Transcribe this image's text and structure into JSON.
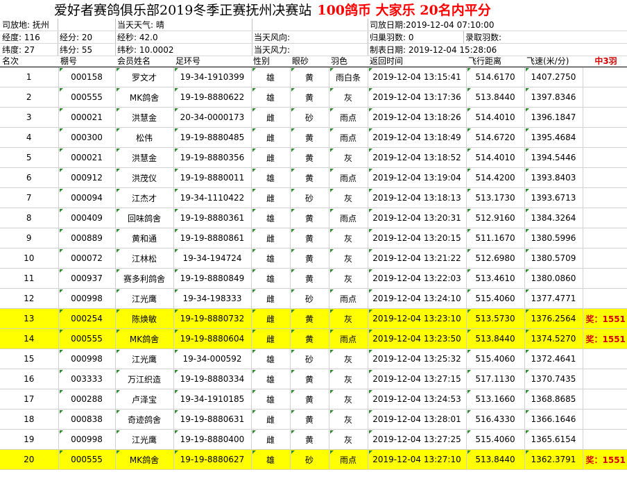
{
  "title": {
    "main": "爱好者赛鸽俱乐部2019冬季正赛抚州决赛站",
    "highlight": "100鸽币 大家乐  20名内平分"
  },
  "info": {
    "row1": {
      "release_place": "司放地: 抚州",
      "weather": "当天天气: 晴",
      "release_date": "司放日期:2019-12-04 07:10:00"
    },
    "row2": {
      "lon_deg": "经度: 116",
      "lon_min": "经分: 20",
      "lon_sec": "经秒: 42.0",
      "wind_dir": "当天风向:",
      "return_count": "归巢羽数: 0",
      "accepted_count": "录取羽数:"
    },
    "row3": {
      "lat_deg": "纬度:  27",
      "lat_min": "纬分: 55",
      "lat_sec": "纬秒: 10.0002",
      "wind_force": "当天风力:",
      "report_date": "制表日期: 2019-12-04 15:28:06"
    }
  },
  "table": {
    "headers": [
      "名次",
      "棚号",
      "会员姓名",
      "足环号",
      "性别",
      "眼砂",
      "羽色",
      "返回时间",
      "飞行距离",
      "飞速(米/分)",
      "中3羽"
    ],
    "rows": [
      {
        "rank": "1",
        "loft": "000158",
        "name": "罗文才",
        "ring": "19-34-1910399",
        "sex": "雄",
        "eye": "黄",
        "color": "雨白条",
        "time": "2019-12-04 13:15:41",
        "dist": "514.6170",
        "speed": "1407.2750",
        "prize": "",
        "hl": false
      },
      {
        "rank": "2",
        "loft": "000555",
        "name": "MK鸽舍",
        "ring": "19-19-8880622",
        "sex": "雄",
        "eye": "黄",
        "color": "灰",
        "time": "2019-12-04 13:17:36",
        "dist": "513.8440",
        "speed": "1397.8346",
        "prize": "",
        "hl": false
      },
      {
        "rank": "3",
        "loft": "000021",
        "name": "洪慧金",
        "ring": "20-34-0000173",
        "sex": "雌",
        "eye": "砂",
        "color": "雨点",
        "time": "2019-12-04 13:18:26",
        "dist": "514.4010",
        "speed": "1396.1847",
        "prize": "",
        "hl": false
      },
      {
        "rank": "4",
        "loft": "000300",
        "name": "松伟",
        "ring": "19-19-8880485",
        "sex": "雌",
        "eye": "黄",
        "color": "雨点",
        "time": "2019-12-04 13:18:49",
        "dist": "514.6720",
        "speed": "1395.4684",
        "prize": "",
        "hl": false
      },
      {
        "rank": "5",
        "loft": "000021",
        "name": "洪慧金",
        "ring": "19-19-8880356",
        "sex": "雌",
        "eye": "黄",
        "color": "灰",
        "time": "2019-12-04 13:18:52",
        "dist": "514.4010",
        "speed": "1394.5446",
        "prize": "",
        "hl": false
      },
      {
        "rank": "6",
        "loft": "000912",
        "name": "洪茂仪",
        "ring": "19-19-8880011",
        "sex": "雄",
        "eye": "黄",
        "color": "雨点",
        "time": "2019-12-04 13:19:04",
        "dist": "514.4200",
        "speed": "1393.8403",
        "prize": "",
        "hl": false
      },
      {
        "rank": "7",
        "loft": "000094",
        "name": "江杰才",
        "ring": "19-34-1110422",
        "sex": "雌",
        "eye": "砂",
        "color": "灰",
        "time": "2019-12-04 13:18:13",
        "dist": "513.1730",
        "speed": "1393.6713",
        "prize": "",
        "hl": false
      },
      {
        "rank": "8",
        "loft": "000409",
        "name": "回味鸽舍",
        "ring": "19-19-8880361",
        "sex": "雄",
        "eye": "黄",
        "color": "雨点",
        "time": "2019-12-04 13:20:31",
        "dist": "512.9160",
        "speed": "1384.3264",
        "prize": "",
        "hl": false
      },
      {
        "rank": "9",
        "loft": "000889",
        "name": "黄和通",
        "ring": "19-19-8880861",
        "sex": "雌",
        "eye": "黄",
        "color": "灰",
        "time": "2019-12-04 13:20:15",
        "dist": "511.1670",
        "speed": "1380.5996",
        "prize": "",
        "hl": false
      },
      {
        "rank": "10",
        "loft": "000072",
        "name": "江林松",
        "ring": "19-34-194724",
        "sex": "雄",
        "eye": "黄",
        "color": "灰",
        "time": "2019-12-04 13:21:22",
        "dist": "512.6980",
        "speed": "1380.5709",
        "prize": "",
        "hl": false
      },
      {
        "rank": "11",
        "loft": "000937",
        "name": "赛多利鸽舍",
        "ring": "19-19-8880849",
        "sex": "雄",
        "eye": "黄",
        "color": "灰",
        "time": "2019-12-04 13:22:03",
        "dist": "513.4610",
        "speed": "1380.0860",
        "prize": "",
        "hl": false
      },
      {
        "rank": "12",
        "loft": "000998",
        "name": "江光鹰",
        "ring": "19-34-198333",
        "sex": "雌",
        "eye": "砂",
        "color": "雨点",
        "time": "2019-12-04 13:24:10",
        "dist": "515.4060",
        "speed": "1377.4771",
        "prize": "",
        "hl": false
      },
      {
        "rank": "13",
        "loft": "000254",
        "name": "陈焕敏",
        "ring": "19-19-8880732",
        "sex": "雌",
        "eye": "黄",
        "color": "灰",
        "time": "2019-12-04 13:23:10",
        "dist": "513.5730",
        "speed": "1376.2564",
        "prize": "奖：1551",
        "hl": true
      },
      {
        "rank": "14",
        "loft": "000555",
        "name": "MK鸽舍",
        "ring": "19-19-8880604",
        "sex": "雌",
        "eye": "黄",
        "color": "雨点",
        "time": "2019-12-04 13:23:50",
        "dist": "513.8440",
        "speed": "1374.5270",
        "prize": "奖：1551",
        "hl": true
      },
      {
        "rank": "15",
        "loft": "000998",
        "name": "江光鹰",
        "ring": "19-34-000592",
        "sex": "雄",
        "eye": "砂",
        "color": "灰",
        "time": "2019-12-04 13:25:32",
        "dist": "515.4060",
        "speed": "1372.4641",
        "prize": "",
        "hl": false
      },
      {
        "rank": "16",
        "loft": "003333",
        "name": "万江织造",
        "ring": "19-19-8880334",
        "sex": "雄",
        "eye": "黄",
        "color": "灰",
        "time": "2019-12-04 13:27:15",
        "dist": "517.1130",
        "speed": "1370.7435",
        "prize": "",
        "hl": false
      },
      {
        "rank": "17",
        "loft": "000288",
        "name": "卢泽宝",
        "ring": "19-34-1910185",
        "sex": "雄",
        "eye": "黄",
        "color": "灰",
        "time": "2019-12-04 13:24:53",
        "dist": "513.1660",
        "speed": "1368.8685",
        "prize": "",
        "hl": false
      },
      {
        "rank": "18",
        "loft": "000838",
        "name": "奇迹鸽舍",
        "ring": "19-19-8880631",
        "sex": "雌",
        "eye": "黄",
        "color": "灰",
        "time": "2019-12-04 13:28:01",
        "dist": "516.4330",
        "speed": "1366.1646",
        "prize": "",
        "hl": false
      },
      {
        "rank": "19",
        "loft": "000998",
        "name": "江光鹰",
        "ring": "19-19-8880400",
        "sex": "雌",
        "eye": "黄",
        "color": "灰",
        "time": "2019-12-04 13:27:25",
        "dist": "515.4060",
        "speed": "1365.6154",
        "prize": "",
        "hl": false
      },
      {
        "rank": "20",
        "loft": "000555",
        "name": "MK鸽舍",
        "ring": "19-19-8880627",
        "sex": "雄",
        "eye": "砂",
        "color": "雨点",
        "time": "2019-12-04 13:27:10",
        "dist": "513.8440",
        "speed": "1362.3791",
        "prize": "奖：1551",
        "hl": true
      }
    ]
  },
  "colors": {
    "highlight_bg": "#ffff00",
    "title_red": "#ff0000",
    "prize_red": "#d40000",
    "corner_mark": "#2e8b2e"
  }
}
